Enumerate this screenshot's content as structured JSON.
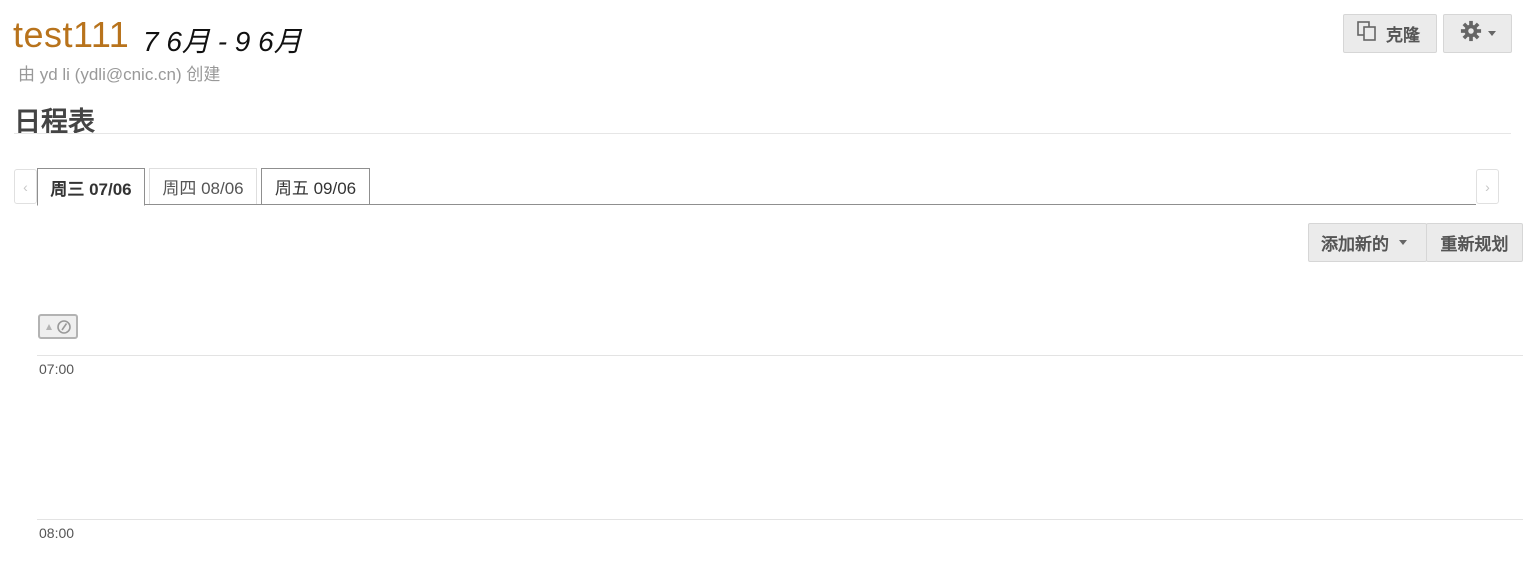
{
  "header": {
    "title": "test111",
    "date_range": "7 6月 - 9 6月",
    "created_by": "由 yd li (ydli@cnic.cn) 创建"
  },
  "toolbar": {
    "clone_label": "克隆",
    "clone_icon": "copy-icon",
    "settings_icon": "gear-icon"
  },
  "section": {
    "heading": "日程表"
  },
  "days": {
    "tabs": [
      {
        "label": "周三 07/06",
        "active": true
      },
      {
        "label": "周四 08/06",
        "active": false
      },
      {
        "label": "周五 09/06",
        "active": false
      }
    ],
    "prev_glyph": "‹",
    "next_glyph": "›"
  },
  "actions": {
    "add_new_label": "添加新的",
    "reschedule_label": "重新规划"
  },
  "timeline": {
    "toggle_icon": "expand-timeline-icon",
    "hours": [
      "07:00",
      "08:00"
    ]
  },
  "colors": {
    "title": "#b8731c",
    "button_bg": "#ebebeb",
    "text_muted": "#999999"
  }
}
